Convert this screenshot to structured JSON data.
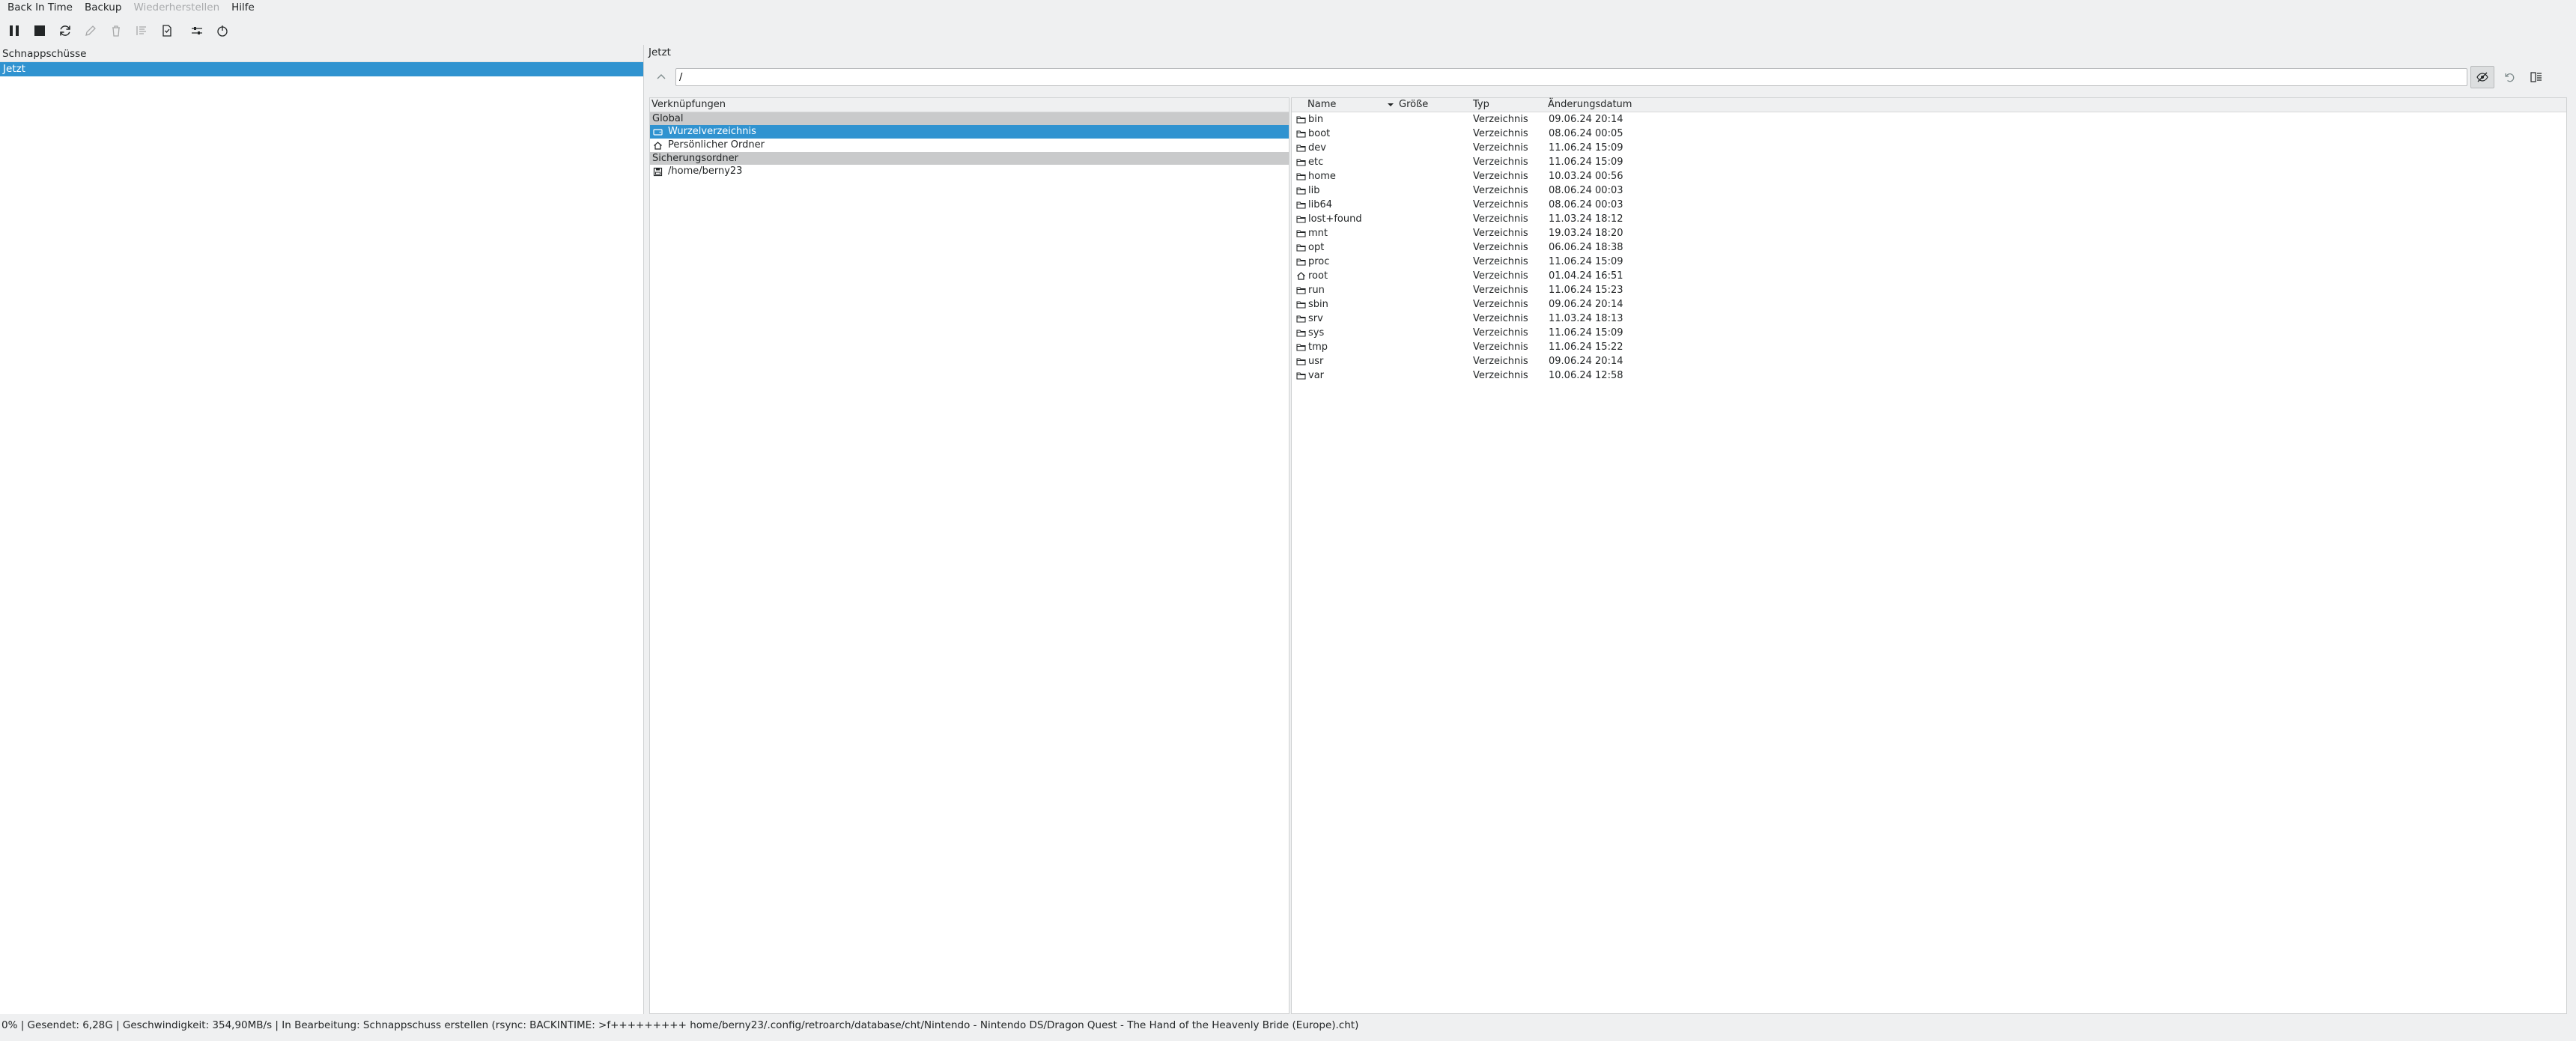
{
  "menu": {
    "app": "Back In Time",
    "backup": "Backup",
    "restore": "Wiederherstellen",
    "help": "Hilfe"
  },
  "toolbar": {
    "icons": [
      "pause-icon",
      "stop-icon",
      "refresh-icon",
      "edit-icon",
      "delete-icon",
      "list-icon",
      "file-log-icon",
      "settings-sliders-icon",
      "power-icon"
    ]
  },
  "snapshots": {
    "header": "Schnappschüsse",
    "items": [
      {
        "label": "Jetzt",
        "selected": true
      }
    ]
  },
  "right": {
    "title": "Jetzt",
    "path": "/"
  },
  "places": {
    "header": "Verknüpfungen",
    "sections": [
      {
        "title": "Global",
        "items": [
          {
            "label": "Wurzelverzeichnis",
            "icon": "drive-icon",
            "selected": true
          },
          {
            "label": "Persönlicher Ordner",
            "icon": "home-icon",
            "selected": false
          }
        ]
      },
      {
        "title": "Sicherungsordner",
        "items": [
          {
            "label": "/home/berny23",
            "icon": "floppy-icon",
            "selected": false
          }
        ]
      }
    ]
  },
  "files": {
    "headers": {
      "name": "Name",
      "size": "Größe",
      "type": "Typ",
      "date": "Änderungsdatum"
    },
    "rows": [
      {
        "name": "bin",
        "type": "Verzeichnis",
        "date": "09.06.24 20:14",
        "icon": "folder-icon"
      },
      {
        "name": "boot",
        "type": "Verzeichnis",
        "date": "08.06.24 00:05",
        "icon": "folder-icon"
      },
      {
        "name": "dev",
        "type": "Verzeichnis",
        "date": "11.06.24 15:09",
        "icon": "folder-icon"
      },
      {
        "name": "etc",
        "type": "Verzeichnis",
        "date": "11.06.24 15:09",
        "icon": "folder-icon"
      },
      {
        "name": "home",
        "type": "Verzeichnis",
        "date": "10.03.24 00:56",
        "icon": "folder-icon"
      },
      {
        "name": "lib",
        "type": "Verzeichnis",
        "date": "08.06.24 00:03",
        "icon": "folder-icon"
      },
      {
        "name": "lib64",
        "type": "Verzeichnis",
        "date": "08.06.24 00:03",
        "icon": "folder-icon"
      },
      {
        "name": "lost+found",
        "type": "Verzeichnis",
        "date": "11.03.24 18:12",
        "icon": "folder-icon"
      },
      {
        "name": "mnt",
        "type": "Verzeichnis",
        "date": "19.03.24 18:20",
        "icon": "folder-icon"
      },
      {
        "name": "opt",
        "type": "Verzeichnis",
        "date": "06.06.24 18:38",
        "icon": "folder-icon"
      },
      {
        "name": "proc",
        "type": "Verzeichnis",
        "date": "11.06.24 15:09",
        "icon": "folder-icon"
      },
      {
        "name": "root",
        "type": "Verzeichnis",
        "date": "01.04.24 16:51",
        "icon": "home-icon"
      },
      {
        "name": "run",
        "type": "Verzeichnis",
        "date": "11.06.24 15:23",
        "icon": "folder-icon"
      },
      {
        "name": "sbin",
        "type": "Verzeichnis",
        "date": "09.06.24 20:14",
        "icon": "folder-icon"
      },
      {
        "name": "srv",
        "type": "Verzeichnis",
        "date": "11.03.24 18:13",
        "icon": "folder-icon"
      },
      {
        "name": "sys",
        "type": "Verzeichnis",
        "date": "11.06.24 15:09",
        "icon": "folder-icon"
      },
      {
        "name": "tmp",
        "type": "Verzeichnis",
        "date": "11.06.24 15:22",
        "icon": "folder-icon"
      },
      {
        "name": "usr",
        "type": "Verzeichnis",
        "date": "09.06.24 20:14",
        "icon": "folder-icon"
      },
      {
        "name": "var",
        "type": "Verzeichnis",
        "date": "10.06.24 12:58",
        "icon": "folder-icon"
      }
    ]
  },
  "status": {
    "text": "0% | Gesendet: 6,28G | Geschwindigkeit: 354,90MB/s | In Bearbeitung: Schnappschuss erstellen (rsync: BACKINTIME: >f+++++++++ home/berny23/.config/retroarch/database/cht/Nintendo - Nintendo DS/Dragon Quest - The Hand of the Heavenly Bride (Europe).cht)"
  },
  "colors": {
    "selection": "#3093d0",
    "section": "#c9cacb",
    "background": "#eff0f1"
  }
}
